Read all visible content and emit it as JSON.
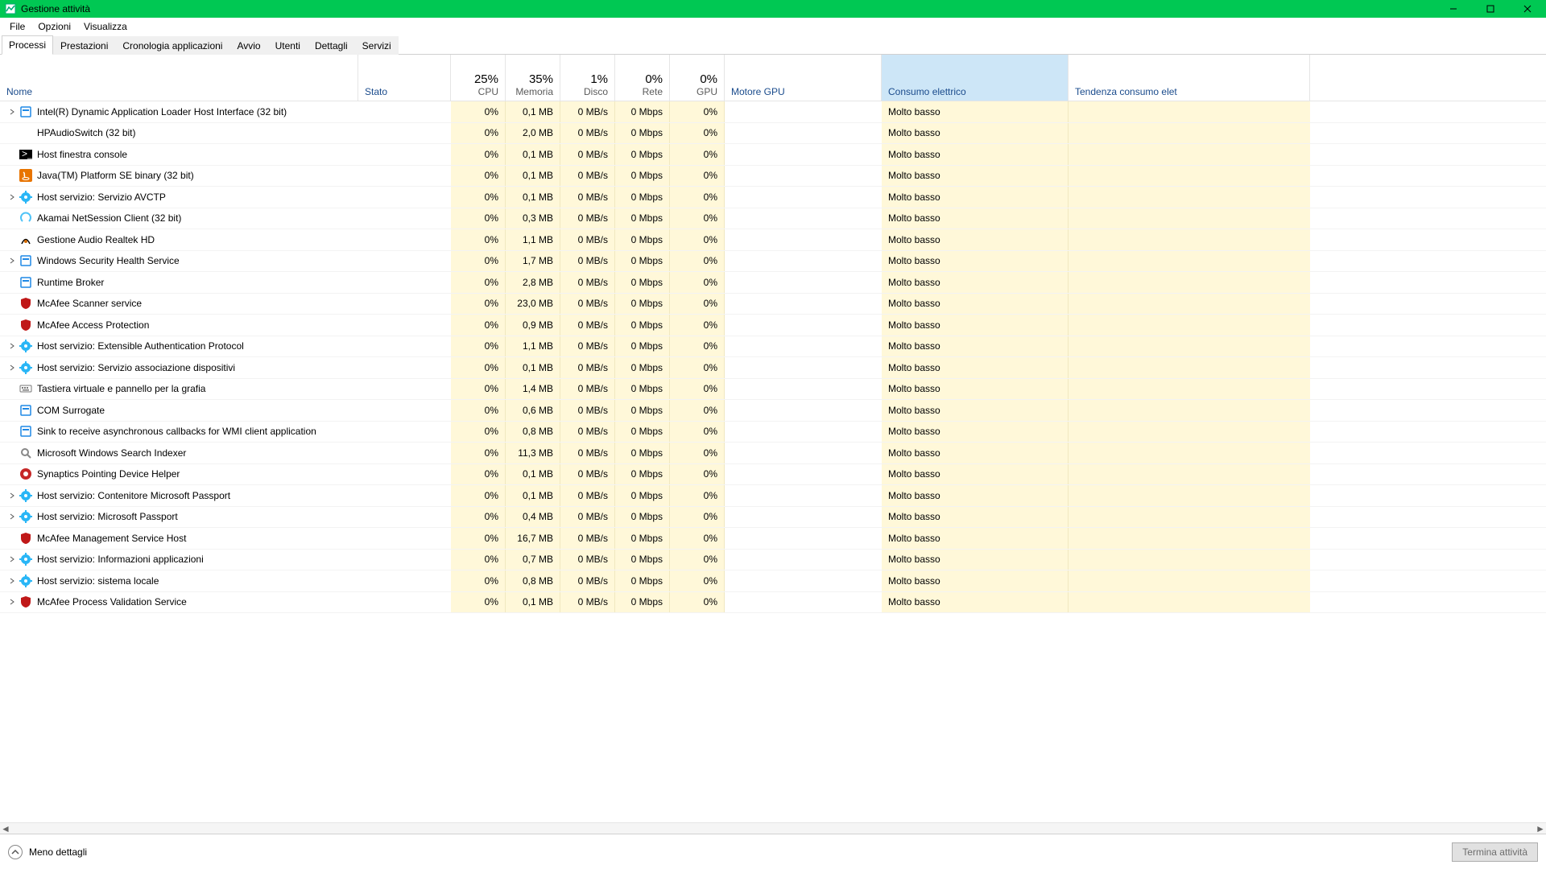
{
  "window": {
    "title": "Gestione attività"
  },
  "menu": {
    "file": "File",
    "options": "Opzioni",
    "view": "Visualizza"
  },
  "tabs": {
    "items": [
      {
        "label": "Processi",
        "active": true
      },
      {
        "label": "Prestazioni",
        "active": false
      },
      {
        "label": "Cronologia applicazioni",
        "active": false
      },
      {
        "label": "Avvio",
        "active": false
      },
      {
        "label": "Utenti",
        "active": false
      },
      {
        "label": "Dettagli",
        "active": false
      },
      {
        "label": "Servizi",
        "active": false
      }
    ]
  },
  "columns": {
    "name": "Nome",
    "status": "Stato",
    "cpu_pct": "25%",
    "cpu": "CPU",
    "mem_pct": "35%",
    "mem": "Memoria",
    "disk_pct": "1%",
    "disk": "Disco",
    "net_pct": "0%",
    "net": "Rete",
    "gpu_pct": "0%",
    "gpu": "GPU",
    "gpu_engine": "Motore GPU",
    "power": "Consumo elettrico",
    "trend": "Tendenza consumo elet"
  },
  "footer": {
    "less_details": "Meno dettagli",
    "end_task": "Termina attività"
  },
  "processes": [
    {
      "exp": true,
      "icon": "generic-blue",
      "name": "Intel(R) Dynamic Application Loader Host Interface (32 bit)",
      "cpu": "0%",
      "mem": "0,1 MB",
      "disk": "0 MB/s",
      "net": "0 Mbps",
      "gpu": "0%",
      "power": "Molto basso"
    },
    {
      "exp": false,
      "icon": "none",
      "name": "HPAudioSwitch (32 bit)",
      "cpu": "0%",
      "mem": "2,0 MB",
      "disk": "0 MB/s",
      "net": "0 Mbps",
      "gpu": "0%",
      "power": "Molto basso"
    },
    {
      "exp": false,
      "icon": "console",
      "name": "Host finestra console",
      "cpu": "0%",
      "mem": "0,1 MB",
      "disk": "0 MB/s",
      "net": "0 Mbps",
      "gpu": "0%",
      "power": "Molto basso"
    },
    {
      "exp": false,
      "icon": "java",
      "name": "Java(TM) Platform SE binary (32 bit)",
      "cpu": "0%",
      "mem": "0,1 MB",
      "disk": "0 MB/s",
      "net": "0 Mbps",
      "gpu": "0%",
      "power": "Molto basso"
    },
    {
      "exp": true,
      "icon": "gear",
      "name": "Host servizio: Servizio AVCTP",
      "cpu": "0%",
      "mem": "0,1 MB",
      "disk": "0 MB/s",
      "net": "0 Mbps",
      "gpu": "0%",
      "power": "Molto basso"
    },
    {
      "exp": false,
      "icon": "akamai",
      "name": "Akamai NetSession Client (32 bit)",
      "cpu": "0%",
      "mem": "0,3 MB",
      "disk": "0 MB/s",
      "net": "0 Mbps",
      "gpu": "0%",
      "power": "Molto basso"
    },
    {
      "exp": false,
      "icon": "realtek",
      "name": "Gestione Audio Realtek HD",
      "cpu": "0%",
      "mem": "1,1 MB",
      "disk": "0 MB/s",
      "net": "0 Mbps",
      "gpu": "0%",
      "power": "Molto basso"
    },
    {
      "exp": true,
      "icon": "generic-blue",
      "name": "Windows Security Health Service",
      "cpu": "0%",
      "mem": "1,7 MB",
      "disk": "0 MB/s",
      "net": "0 Mbps",
      "gpu": "0%",
      "power": "Molto basso"
    },
    {
      "exp": false,
      "icon": "generic-blue",
      "name": "Runtime Broker",
      "cpu": "0%",
      "mem": "2,8 MB",
      "disk": "0 MB/s",
      "net": "0 Mbps",
      "gpu": "0%",
      "power": "Molto basso"
    },
    {
      "exp": false,
      "icon": "mcafee",
      "name": "McAfee Scanner service",
      "cpu": "0%",
      "mem": "23,0 MB",
      "disk": "0 MB/s",
      "net": "0 Mbps",
      "gpu": "0%",
      "power": "Molto basso"
    },
    {
      "exp": false,
      "icon": "mcafee",
      "name": "McAfee Access Protection",
      "cpu": "0%",
      "mem": "0,9 MB",
      "disk": "0 MB/s",
      "net": "0 Mbps",
      "gpu": "0%",
      "power": "Molto basso"
    },
    {
      "exp": true,
      "icon": "gear",
      "name": "Host servizio: Extensible Authentication Protocol",
      "cpu": "0%",
      "mem": "1,1 MB",
      "disk": "0 MB/s",
      "net": "0 Mbps",
      "gpu": "0%",
      "power": "Molto basso"
    },
    {
      "exp": true,
      "icon": "gear",
      "name": "Host servizio: Servizio associazione dispositivi",
      "cpu": "0%",
      "mem": "0,1 MB",
      "disk": "0 MB/s",
      "net": "0 Mbps",
      "gpu": "0%",
      "power": "Molto basso"
    },
    {
      "exp": false,
      "icon": "keyboard",
      "name": "Tastiera virtuale e pannello per la grafia",
      "cpu": "0%",
      "mem": "1,4 MB",
      "disk": "0 MB/s",
      "net": "0 Mbps",
      "gpu": "0%",
      "power": "Molto basso"
    },
    {
      "exp": false,
      "icon": "generic-blue",
      "name": "COM Surrogate",
      "cpu": "0%",
      "mem": "0,6 MB",
      "disk": "0 MB/s",
      "net": "0 Mbps",
      "gpu": "0%",
      "power": "Molto basso"
    },
    {
      "exp": false,
      "icon": "generic-blue",
      "name": "Sink to receive asynchronous callbacks for WMI client application",
      "cpu": "0%",
      "mem": "0,8 MB",
      "disk": "0 MB/s",
      "net": "0 Mbps",
      "gpu": "0%",
      "power": "Molto basso"
    },
    {
      "exp": false,
      "icon": "search",
      "name": "Microsoft Windows Search Indexer",
      "cpu": "0%",
      "mem": "11,3 MB",
      "disk": "0 MB/s",
      "net": "0 Mbps",
      "gpu": "0%",
      "power": "Molto basso"
    },
    {
      "exp": false,
      "icon": "synaptics",
      "name": "Synaptics Pointing Device Helper",
      "cpu": "0%",
      "mem": "0,1 MB",
      "disk": "0 MB/s",
      "net": "0 Mbps",
      "gpu": "0%",
      "power": "Molto basso"
    },
    {
      "exp": true,
      "icon": "gear",
      "name": "Host servizio: Contenitore Microsoft Passport",
      "cpu": "0%",
      "mem": "0,1 MB",
      "disk": "0 MB/s",
      "net": "0 Mbps",
      "gpu": "0%",
      "power": "Molto basso"
    },
    {
      "exp": true,
      "icon": "gear",
      "name": "Host servizio: Microsoft Passport",
      "cpu": "0%",
      "mem": "0,4 MB",
      "disk": "0 MB/s",
      "net": "0 Mbps",
      "gpu": "0%",
      "power": "Molto basso"
    },
    {
      "exp": false,
      "icon": "mcafee",
      "name": "McAfee Management Service Host",
      "cpu": "0%",
      "mem": "16,7 MB",
      "disk": "0 MB/s",
      "net": "0 Mbps",
      "gpu": "0%",
      "power": "Molto basso"
    },
    {
      "exp": true,
      "icon": "gear",
      "name": "Host servizio: Informazioni applicazioni",
      "cpu": "0%",
      "mem": "0,7 MB",
      "disk": "0 MB/s",
      "net": "0 Mbps",
      "gpu": "0%",
      "power": "Molto basso"
    },
    {
      "exp": true,
      "icon": "gear",
      "name": "Host servizio: sistema locale",
      "cpu": "0%",
      "mem": "0,8 MB",
      "disk": "0 MB/s",
      "net": "0 Mbps",
      "gpu": "0%",
      "power": "Molto basso"
    },
    {
      "exp": true,
      "icon": "mcafee",
      "name": "McAfee Process Validation Service",
      "cpu": "0%",
      "mem": "0,1 MB",
      "disk": "0 MB/s",
      "net": "0 Mbps",
      "gpu": "0%",
      "power": "Molto basso"
    }
  ],
  "icons": {
    "generic-blue": "#1e88e5",
    "console": "#000000",
    "java": "#e87400",
    "gear": "#29b6f6",
    "akamai": "#4fc3f7",
    "realtek": "#111111",
    "mcafee": "#c01818",
    "keyboard": "#9e9e9e",
    "search": "#bdbdbd",
    "synaptics": "#c62828",
    "none": "transparent"
  }
}
